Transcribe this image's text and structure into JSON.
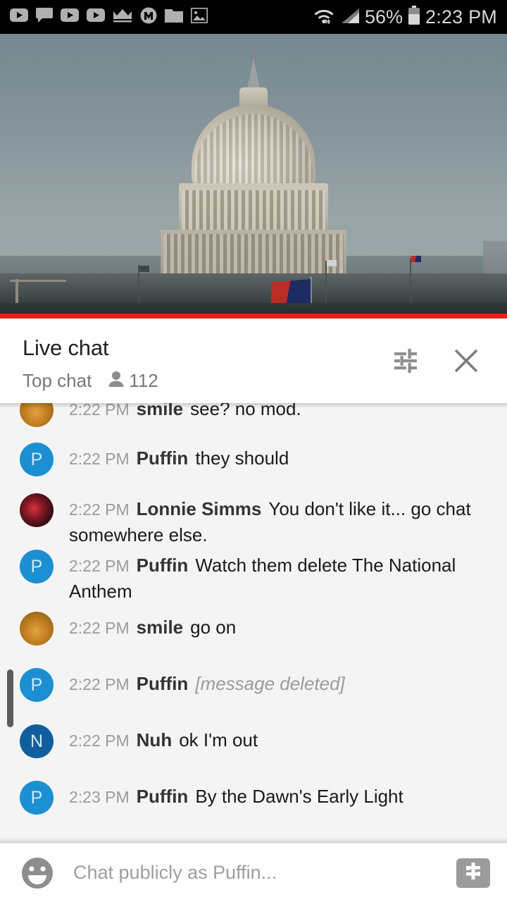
{
  "status_bar": {
    "icons": [
      "youtube-play-icon",
      "chat-bubble-icon",
      "youtube-play-icon",
      "youtube-play-icon",
      "crown-icon",
      "m-circle-icon",
      "folder-icon",
      "image-icon"
    ],
    "wifi_icon": "wifi-icon",
    "signal_icon": "cellular-signal-icon",
    "battery_percent": "56%",
    "battery_icon": "battery-icon",
    "clock": "2:23 PM"
  },
  "video": {
    "name": "us-capitol-live-stream",
    "progress_color": "#ec1c16"
  },
  "chat_header": {
    "title": "Live chat",
    "mode": "Top chat",
    "viewer_icon": "person-icon",
    "viewer_count": "112",
    "settings_icon": "tune-icon",
    "close_icon": "close-icon"
  },
  "messages": [
    {
      "time": "2:22 PM",
      "author": "smile",
      "text": "see? no mod.",
      "avatar_type": "photo-smile",
      "avatar_letter": "",
      "avatar_color": "#c07d22",
      "deleted": false,
      "clipped": true
    },
    {
      "time": "2:22 PM",
      "author": "Puffin",
      "text": "they should",
      "avatar_type": "letter",
      "avatar_letter": "P",
      "avatar_color": "#1b8fd1",
      "deleted": false,
      "clipped": false
    },
    {
      "time": "2:22 PM",
      "author": "Lonnie Simms",
      "text": "You don't like it... go chat somewhere else.",
      "avatar_type": "photo-lonnie",
      "avatar_letter": "",
      "avatar_color": "#7a1622",
      "deleted": false,
      "clipped": false
    },
    {
      "time": "2:22 PM",
      "author": "Puffin",
      "text": "Watch them delete The National Anthem",
      "avatar_type": "letter",
      "avatar_letter": "P",
      "avatar_color": "#1b8fd1",
      "deleted": false,
      "clipped": false
    },
    {
      "time": "2:22 PM",
      "author": "smile",
      "text": "go on",
      "avatar_type": "photo-smile",
      "avatar_letter": "",
      "avatar_color": "#c07d22",
      "deleted": false,
      "clipped": false
    },
    {
      "time": "2:22 PM",
      "author": "Puffin",
      "text": "[message deleted]",
      "avatar_type": "letter",
      "avatar_letter": "P",
      "avatar_color": "#1b8fd1",
      "deleted": true,
      "clipped": false
    },
    {
      "time": "2:22 PM",
      "author": "Nuh",
      "text": "ok I'm out",
      "avatar_type": "letter",
      "avatar_letter": "N",
      "avatar_color": "#115e9e",
      "deleted": false,
      "clipped": false
    },
    {
      "time": "2:23 PM",
      "author": "Puffin",
      "text": "By the Dawn's Early Light",
      "avatar_type": "letter",
      "avatar_letter": "P",
      "avatar_color": "#1b8fd1",
      "deleted": false,
      "clipped": false
    }
  ],
  "input_bar": {
    "emoji_icon": "emoji-smiley-icon",
    "placeholder": "Chat publicly as Puffin...",
    "value": "",
    "superchat_icon": "dollar-sign-icon"
  }
}
